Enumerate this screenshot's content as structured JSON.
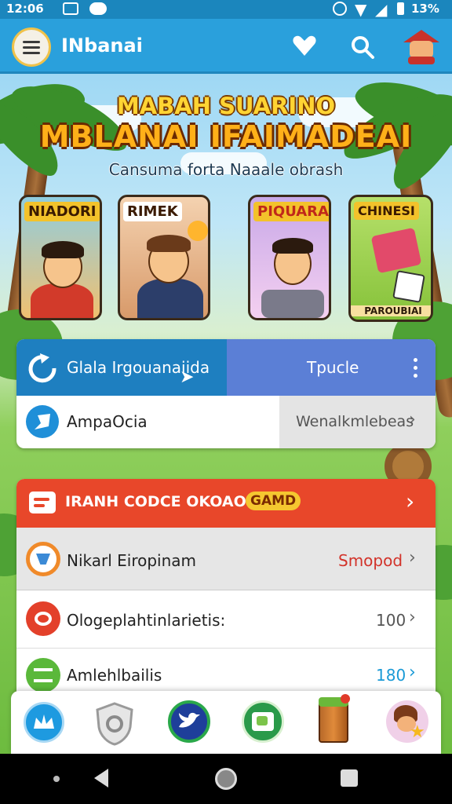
{
  "status_bar": {
    "time": "12:06",
    "battery": "13%"
  },
  "app_bar": {
    "title": "INbanai"
  },
  "hero": {
    "title_line1": "MABAH SUARINO",
    "title_line2": "MBLANAI IFAIMADEAI",
    "subtitle": "Cansuma forta Naaale obrash",
    "cards": [
      {
        "label": "NIADORI"
      },
      {
        "label": "RIMEK"
      },
      {
        "label": "PIQUARAN"
      },
      {
        "label": "CHINESI",
        "caption": "PAROUBIAI"
      }
    ]
  },
  "segment": {
    "left_label": "Glala Irgouanaiida",
    "right_label": "Tpucle"
  },
  "white_row": {
    "label": "AmpaOcia",
    "value": "Wenalkmlebeas"
  },
  "promo_panel": {
    "header": "IRANH CODCE OKOAOM",
    "badge": "GAMD",
    "rows": [
      {
        "label": "Nikarl Eiropinam",
        "value": "Smopod"
      },
      {
        "label": "Ologeplahtinlarietis:",
        "value": "100"
      },
      {
        "label": "Amlehlbailis",
        "value": "180"
      }
    ]
  },
  "colors": {
    "primary": "#2aa0dc",
    "segment_dark": "#1e7fc0",
    "segment_light": "#5b7fd6",
    "promo_red": "#e8472a",
    "badge_yellow": "#f5c730"
  },
  "bottom_nav": [
    {
      "icon": "crown-icon"
    },
    {
      "icon": "shield-icon"
    },
    {
      "icon": "bird-icon"
    },
    {
      "icon": "map-icon"
    },
    {
      "icon": "crate-icon"
    },
    {
      "icon": "avatar-star-icon"
    }
  ]
}
